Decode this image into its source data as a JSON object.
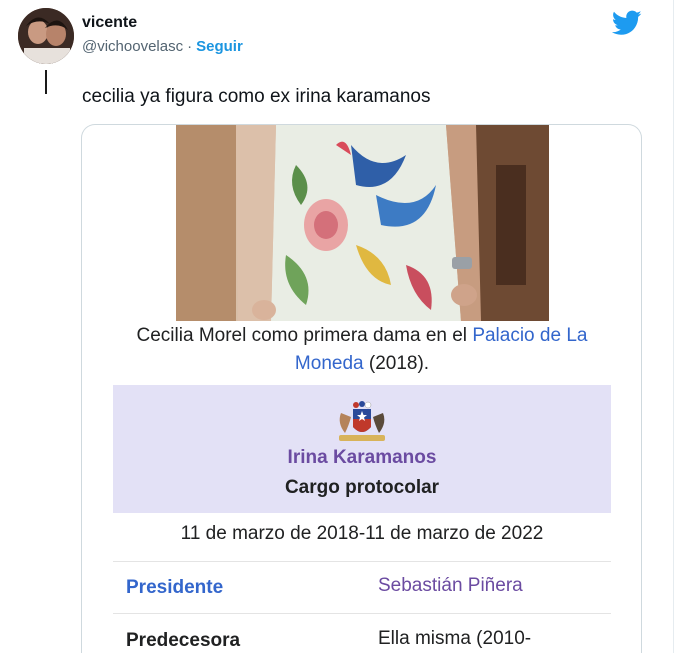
{
  "tweet": {
    "author_name": "vicente",
    "author_handle": "@vichoovelasc",
    "separator": "·",
    "follow_label": "Seguir",
    "text": "cecilia ya figura como ex irina karamanos"
  },
  "wiki": {
    "caption_prefix": "Cecilia Morel como primera dama en el ",
    "caption_link": "Palacio de La Moneda",
    "caption_suffix": " (2018).",
    "office_name": "Irina Karamanos",
    "office_subtitle": "Cargo protocolar",
    "term": "11 de marzo de 2018-11 de marzo de 2022",
    "rows": [
      {
        "label": "Presidente",
        "value": "Sebastián Piñera"
      },
      {
        "label": "Predecesora",
        "value": "Ella misma (2010-"
      }
    ]
  },
  "colors": {
    "twitter_blue": "#1d9bf0",
    "wiki_link": "#3366cc",
    "infobox_header": "#e3e1f6",
    "office_purple": "#6b4ba1"
  }
}
